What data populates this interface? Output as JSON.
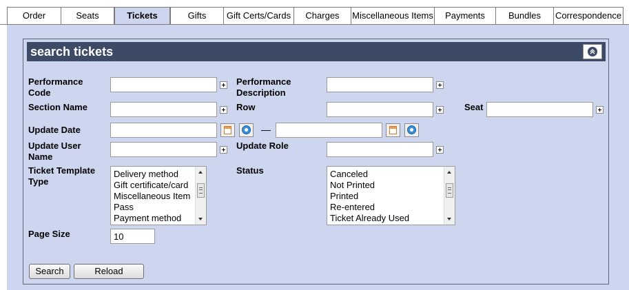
{
  "tabs": [
    {
      "label": "Order",
      "active": false
    },
    {
      "label": "Seats",
      "active": false
    },
    {
      "label": "Tickets",
      "active": true
    },
    {
      "label": "Gifts",
      "active": false
    },
    {
      "label": "Gift Certs/Cards",
      "active": false
    },
    {
      "label": "Charges",
      "active": false
    },
    {
      "label": "Miscellaneous Items",
      "active": false
    },
    {
      "label": "Payments",
      "active": false
    },
    {
      "label": "Bundles",
      "active": false
    },
    {
      "label": "Correspondence",
      "active": false
    }
  ],
  "panel": {
    "title": "search tickets",
    "collapse_icon": "collapse-up-icon"
  },
  "fields": {
    "performance_code": {
      "label_line1": "Performance",
      "label_line2": "Code",
      "value": ""
    },
    "performance_description": {
      "label_line1": "Performance",
      "label_line2": "Description",
      "value": ""
    },
    "section_name": {
      "label": "Section Name",
      "value": ""
    },
    "row": {
      "label": "Row",
      "value": ""
    },
    "seat": {
      "label": "Seat",
      "value": ""
    },
    "update_date": {
      "label": "Update Date",
      "from_value": "",
      "to_value": "",
      "separator": "—"
    },
    "update_user_name": {
      "label_line1": "Update User",
      "label_line2": "Name",
      "value": ""
    },
    "update_role": {
      "label": "Update Role",
      "value": ""
    },
    "ticket_template_type": {
      "label_line1": "Ticket Template",
      "label_line2": "Type",
      "options": [
        "Delivery method",
        "Gift certificate/card",
        "Miscellaneous Item",
        "Pass",
        "Payment method"
      ]
    },
    "status": {
      "label": "Status",
      "options": [
        "Canceled",
        "Not Printed",
        "Printed",
        "Re-entered",
        "Ticket Already Used"
      ]
    },
    "page_size": {
      "label": "Page Size",
      "value": "10"
    }
  },
  "buttons": {
    "search": "Search",
    "reload": "Reload"
  },
  "colors": {
    "panel_bg": "#cdd6ee",
    "header_bg": "#3d4a66",
    "header_text": "#ffffff"
  }
}
